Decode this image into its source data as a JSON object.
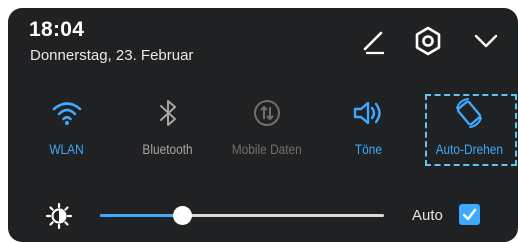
{
  "status": {
    "time": "18:04",
    "date": "Donnerstag, 23. Februar"
  },
  "header_actions": [
    {
      "name": "edit-button",
      "icon": "pencil-icon"
    },
    {
      "name": "settings-button",
      "icon": "gear-icon"
    },
    {
      "name": "collapse-button",
      "icon": "chevron-down-icon"
    }
  ],
  "toggles": [
    {
      "label": "WLAN",
      "icon": "wifi-icon",
      "state": "on"
    },
    {
      "label": "Bluetooth",
      "icon": "bluetooth-icon",
      "state": "off"
    },
    {
      "label": "Mobile Daten",
      "icon": "mobile-data-icon",
      "state": "disabled"
    },
    {
      "label": "Töne",
      "icon": "sound-icon",
      "state": "on"
    },
    {
      "label": "Auto-Drehen",
      "icon": "auto-rotate-icon",
      "state": "on",
      "highlighted": true
    }
  ],
  "brightness": {
    "icon": "brightness-icon",
    "level": 0.29,
    "auto_label": "Auto",
    "auto_checked": true
  },
  "colors": {
    "accent": "#3fa8ff",
    "panel": "#202122",
    "highlight_border": "#62c4ee"
  }
}
